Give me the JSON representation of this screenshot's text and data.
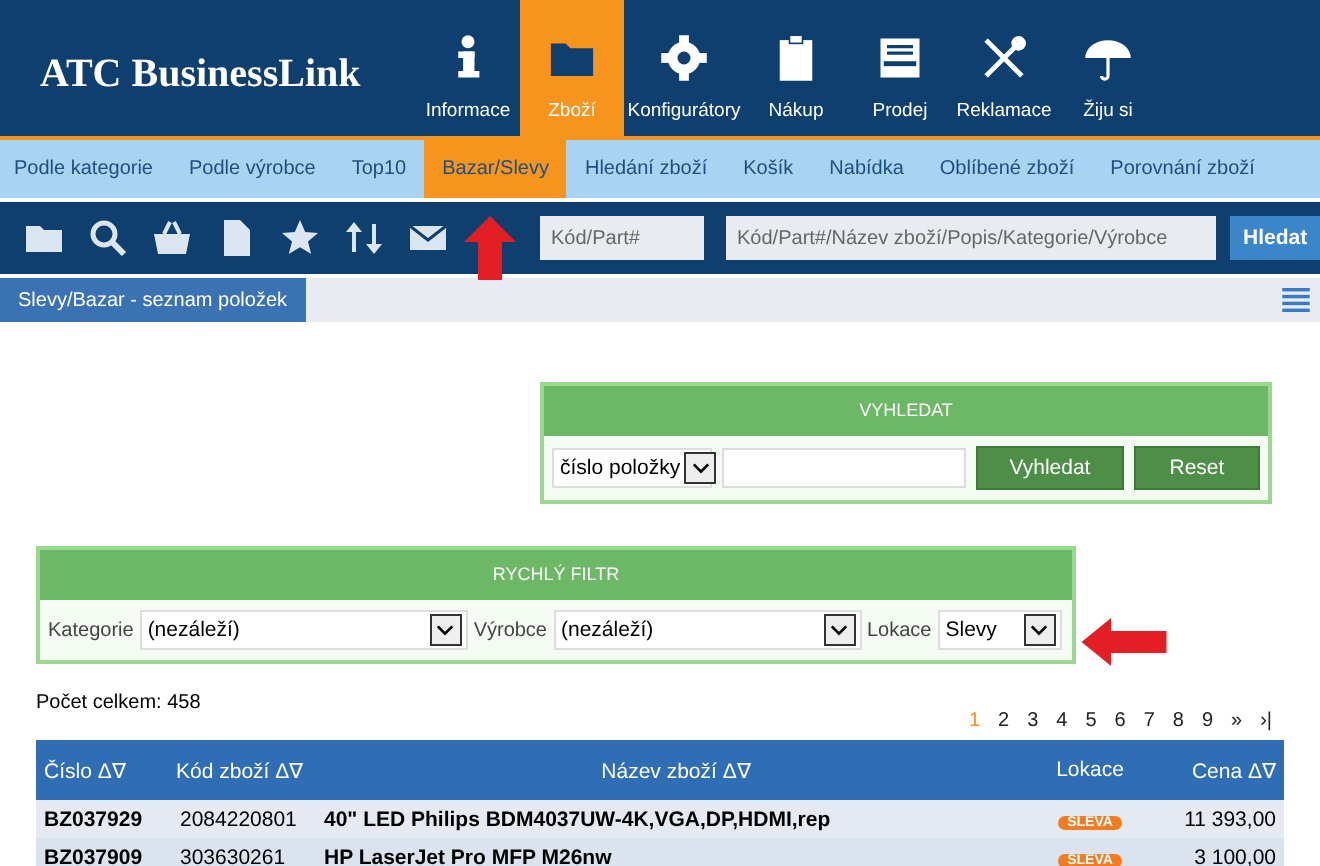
{
  "header": {
    "logo": "ATC BusinessLink"
  },
  "main_nav": [
    {
      "label": "Informace",
      "selected": false,
      "kind": "info"
    },
    {
      "label": "Zboží",
      "selected": true,
      "kind": "folder"
    },
    {
      "label": "Konfigurátory",
      "selected": false,
      "kind": "gear"
    },
    {
      "label": "Nákup",
      "selected": false,
      "kind": "clipboard"
    },
    {
      "label": "Prodej",
      "selected": false,
      "kind": "tray"
    },
    {
      "label": "Reklamace",
      "selected": false,
      "kind": "tools"
    },
    {
      "label": "Žiju si",
      "selected": false,
      "kind": "umbrella"
    }
  ],
  "sub_nav": [
    {
      "label": "Podle kategorie",
      "selected": false
    },
    {
      "label": "Podle výrobce",
      "selected": false
    },
    {
      "label": "Top10",
      "selected": false
    },
    {
      "label": "Bazar/Slevy",
      "selected": true
    },
    {
      "label": "Hledání zboží",
      "selected": false
    },
    {
      "label": "Košík",
      "selected": false
    },
    {
      "label": "Nabídka",
      "selected": false
    },
    {
      "label": "Oblíbené zboží",
      "selected": false
    },
    {
      "label": "Porovnání zboží",
      "selected": false
    }
  ],
  "toolbar": {
    "code_placeholder": "Kód/Part#",
    "search_placeholder": "Kód/Part#/Název zboží/Popis/Kategorie/Výrobce",
    "button": "Hledat"
  },
  "breadcrumb": "Slevy/Bazar - seznam položek",
  "search_panel": {
    "title": "VYHLEDAT",
    "field_select": "číslo položky",
    "buttons": [
      "Vyhledat",
      "Reset"
    ]
  },
  "filter_panel": {
    "title": "RYCHLÝ FILTR",
    "filters": [
      {
        "label": "Kategorie",
        "value": "(nezáleží)"
      },
      {
        "label": "Výrobce",
        "value": "(nezáleží)"
      },
      {
        "label": "Lokace",
        "value": "Slevy"
      }
    ]
  },
  "count": "Počet celkem: 458",
  "pagination": [
    {
      "label": "1",
      "selected": true
    },
    {
      "label": "2",
      "selected": false
    },
    {
      "label": "3",
      "selected": false
    },
    {
      "label": "4",
      "selected": false
    },
    {
      "label": "5",
      "selected": false
    },
    {
      "label": "6",
      "selected": false
    },
    {
      "label": "7",
      "selected": false
    },
    {
      "label": "8",
      "selected": false
    },
    {
      "label": "9",
      "selected": false
    },
    {
      "label": "»",
      "selected": false
    },
    {
      "label": "›|",
      "selected": false
    }
  ],
  "table": {
    "columns": [
      "Číslo Δ∇",
      "Kód zboží Δ∇",
      "Název zboží Δ∇",
      "Lokace",
      "Cena Δ∇"
    ],
    "rows": [
      {
        "cislo": "BZ037929",
        "kod": "2084220801",
        "nazev": "40\" LED Philips BDM4037UW-4K,VGA,DP,HDMI,rep",
        "lokace": "SLEVA",
        "cena": "11 393,00"
      },
      {
        "cislo": "BZ037909",
        "kod": "303630261",
        "nazev": "HP LaserJet Pro MFP M26nw",
        "lokace": "SLEVA",
        "cena": "3 100,00"
      }
    ]
  }
}
